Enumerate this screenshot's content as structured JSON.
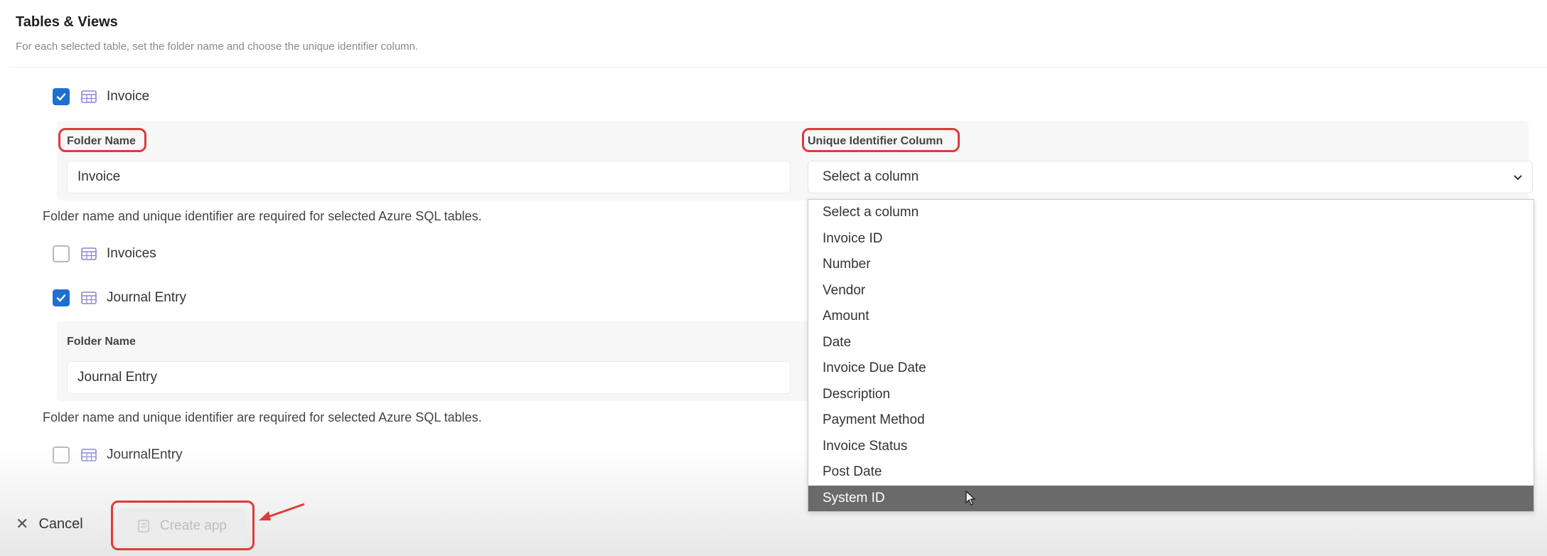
{
  "section": {
    "title": "Tables & Views",
    "subtitle": "For each selected table, set the folder name and choose the unique identifier column."
  },
  "tables": [
    {
      "label": "Invoice",
      "checked": true,
      "folder_label": "Folder Name",
      "folder_value": "Invoice",
      "uid_label": "Unique Identifier Column",
      "uid_value": "Select a column",
      "help": "Folder name and unique identifier are required for selected Azure SQL tables."
    },
    {
      "label": "Invoices",
      "checked": false
    },
    {
      "label": "Journal Entry",
      "checked": true,
      "folder_label": "Folder Name",
      "folder_value": "Journal Entry",
      "help": "Folder name and unique identifier are required for selected Azure SQL tables."
    },
    {
      "label": "JournalEntry",
      "checked": false
    }
  ],
  "dropdown": {
    "options": [
      "Select a column",
      "Invoice ID",
      "Number",
      "Vendor",
      "Amount",
      "Date",
      "Invoice Due Date",
      "Description",
      "Payment Method",
      "Invoice Status",
      "Post Date",
      "System ID"
    ],
    "highlighted": "System ID"
  },
  "footer": {
    "cancel_label": "Cancel",
    "create_label": "Create app"
  },
  "colors": {
    "accent": "#1f6fd1",
    "annotation": "#e03a3a",
    "highlight_row": "#6a6a6a"
  }
}
